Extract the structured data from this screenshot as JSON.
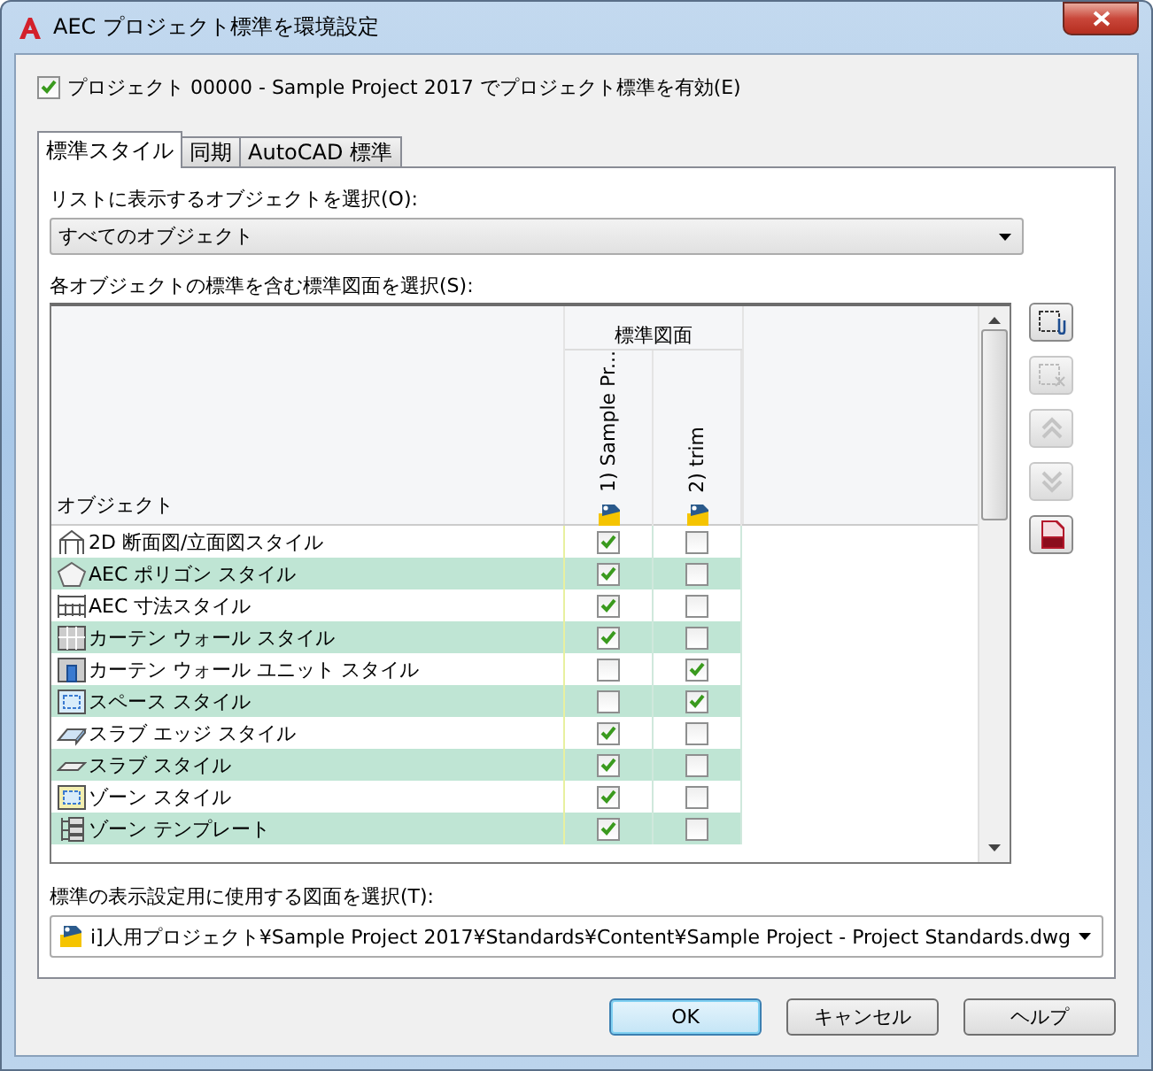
{
  "window": {
    "title": "AEC プロジェクト標準を環境設定"
  },
  "enable": {
    "label": "プロジェクト 00000 - Sample Project 2017 でプロジェクト標準を有効(E)",
    "checked": true
  },
  "tabs": [
    {
      "label": "標準スタイル",
      "selected": true
    },
    {
      "label": "同期",
      "selected": false
    },
    {
      "label": "AutoCAD 標準",
      "selected": false
    }
  ],
  "object_select": {
    "label": "リストに表示するオブジェクトを選択(O):",
    "value": "すべてのオブジェクト"
  },
  "grid_label": "各オブジェクトの標準を含む標準図面を選択(S):",
  "table": {
    "object_header": "オブジェクト",
    "group_header": "標準図面",
    "columns": [
      "1) Sample Pr...",
      "2) trim"
    ],
    "rows": [
      {
        "name": "2D 断面図/立面図スタイル",
        "checks": [
          true,
          false
        ]
      },
      {
        "name": "AEC ポリゴン スタイル",
        "checks": [
          true,
          false
        ]
      },
      {
        "name": "AEC 寸法スタイル",
        "checks": [
          true,
          false
        ]
      },
      {
        "name": "カーテン ウォール スタイル",
        "checks": [
          true,
          false
        ]
      },
      {
        "name": "カーテン ウォール ユニット スタイル",
        "checks": [
          false,
          true
        ]
      },
      {
        "name": "スペース スタイル",
        "checks": [
          false,
          true
        ]
      },
      {
        "name": "スラブ エッジ スタイル",
        "checks": [
          true,
          false
        ]
      },
      {
        "name": "スラブ スタイル",
        "checks": [
          true,
          false
        ]
      },
      {
        "name": "ゾーン スタイル",
        "checks": [
          true,
          false
        ]
      },
      {
        "name": "ゾーン テンプレート",
        "checks": [
          true,
          false
        ]
      }
    ]
  },
  "side_buttons": [
    {
      "disabled": false
    },
    {
      "disabled": true
    },
    {
      "disabled": true
    },
    {
      "disabled": true
    },
    {
      "disabled": false
    }
  ],
  "display_select": {
    "label": "標準の表示設定用に使用する図面を選択(T):",
    "value": "i]人用プロジェクト¥Sample Project 2017¥Standards¥Content¥Sample Project - Project Standards.dwg"
  },
  "buttons": [
    {
      "label": "OK",
      "default": true
    },
    {
      "label": "キャンセル",
      "default": false
    },
    {
      "label": "ヘルプ",
      "default": false
    }
  ]
}
